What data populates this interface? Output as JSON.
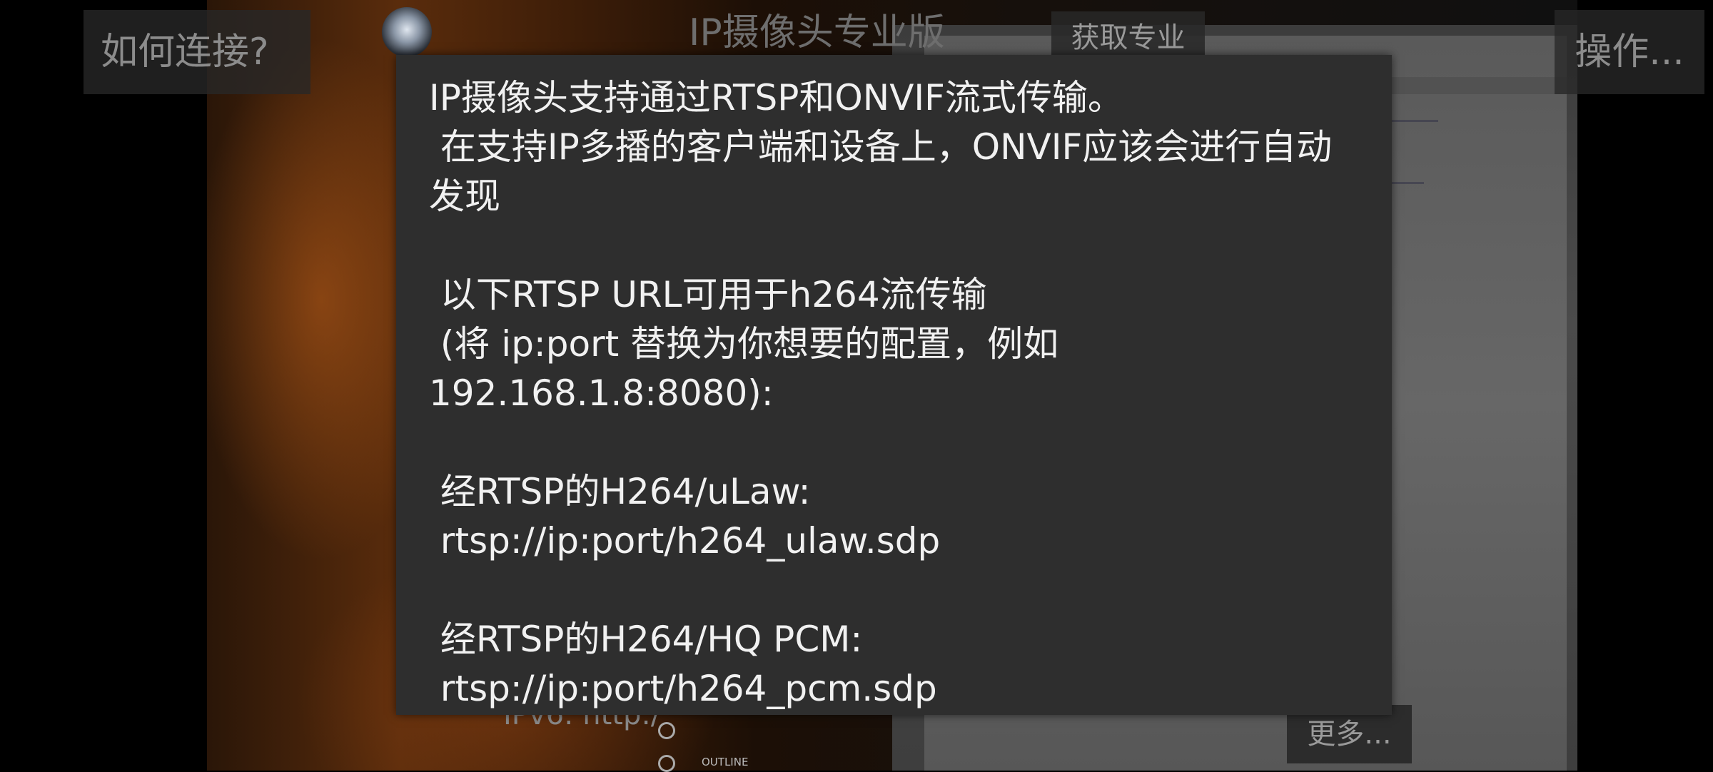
{
  "header": {
    "how_to_connect": "如何连接?",
    "app_title": "IP摄像头专业版",
    "get_pro": "获取专业",
    "actions": "操作..."
  },
  "background": {
    "ip_partial": "IPv6: http:/",
    "outline_label": "OUTLINE"
  },
  "dialog": {
    "text": "IP摄像头支持通过RTSP和ONVIF流式传输。\n 在支持IP多播的客户端和设备上，ONVIF应该会进行自动发现\n\n 以下RTSP URL可用于h264流传输\n (将 ip:port 替换为你想要的配置，例如192.168.1.8:8080):\n\n 经RTSP的H264/uLaw:\n rtsp://ip:port/h264_ulaw.sdp\n\n 经RTSP的H264/HQ PCM:\n rtsp://ip:port/h264_pcm.sdp"
  },
  "footer": {
    "more": "更多..."
  }
}
